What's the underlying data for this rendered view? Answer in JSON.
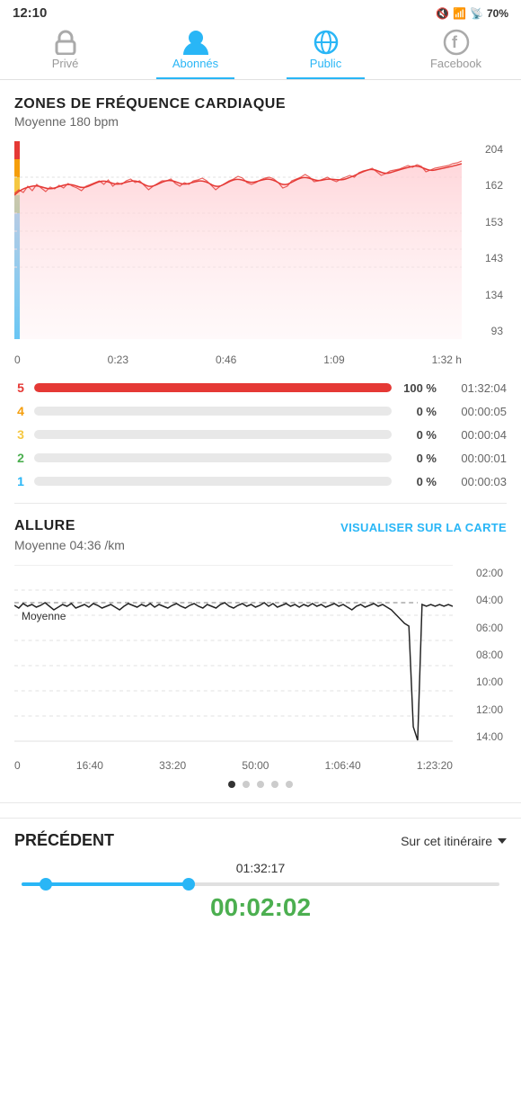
{
  "status": {
    "time": "12:10",
    "battery": "70%",
    "icons": "🔕 📶"
  },
  "tabs": [
    {
      "id": "prive",
      "label": "Privé",
      "active": false
    },
    {
      "id": "abonnes",
      "label": "Abonnés",
      "active": true
    },
    {
      "id": "public",
      "label": "Public",
      "active": true
    },
    {
      "id": "facebook",
      "label": "Facebook",
      "active": false
    }
  ],
  "heart_rate": {
    "section_title": "ZONES DE FRÉQUENCE CARDIAQUE",
    "subtitle": "Moyenne 180 bpm",
    "y_labels": [
      "204",
      "162",
      "153",
      "143",
      "134",
      "93"
    ],
    "x_labels": [
      "0",
      "0:23",
      "0:46",
      "1:09",
      "1:32 h"
    ],
    "zones": [
      {
        "num": "5",
        "color": "#e53935",
        "pct": "100 %",
        "time": "01:32:04",
        "fill": 1.0
      },
      {
        "num": "4",
        "color": "#f59e0b",
        "pct": "0 %",
        "time": "00:00:05",
        "fill": 0.0
      },
      {
        "num": "3",
        "color": "#f5c842",
        "pct": "0 %",
        "time": "00:00:04",
        "fill": 0.0
      },
      {
        "num": "2",
        "color": "#4caf50",
        "pct": "0 %",
        "time": "00:00:01",
        "fill": 0.0
      },
      {
        "num": "1",
        "color": "#29b6f6",
        "pct": "0 %",
        "time": "00:00:03",
        "fill": 0.0
      }
    ]
  },
  "allure": {
    "section_title": "ALLURE",
    "link_label": "VISUALISER SUR LA CARTE",
    "subtitle": "Moyenne 04:36 /km",
    "y_labels": [
      "02:00",
      "04:00",
      "06:00",
      "08:00",
      "10:00",
      "12:00",
      "14:00"
    ],
    "x_labels": [
      "0",
      "16:40",
      "33:20",
      "50:00",
      "1:06:40",
      "1:23:20"
    ],
    "moyenne_label": "Moyenne"
  },
  "pagination": {
    "total": 5,
    "active": 0
  },
  "bottom": {
    "precedent_label": "PRÉCÉDENT",
    "itineraire_label": "Sur cet itinéraire",
    "time_label": "01:32:17",
    "green_time": "00:02:02",
    "slider_left_pct": 5,
    "slider_right_pct": 35
  }
}
